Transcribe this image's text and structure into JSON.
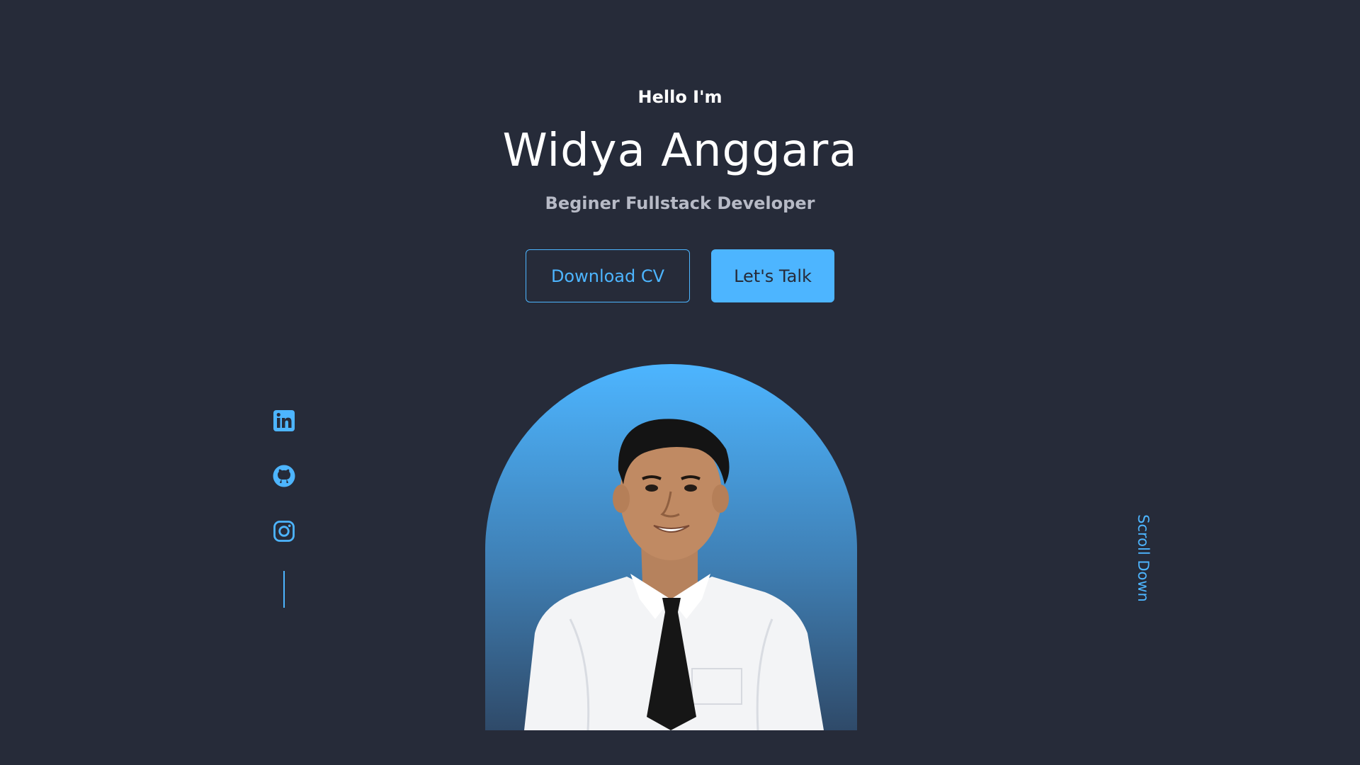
{
  "hero": {
    "greeting": "Hello I'm",
    "name": "Widya Anggara",
    "role": "Beginer Fullstack Developer",
    "buttons": {
      "download_cv": "Download CV",
      "lets_talk": "Let's Talk"
    }
  },
  "socials": [
    {
      "icon": "linkedin-icon"
    },
    {
      "icon": "github-icon"
    },
    {
      "icon": "instagram-icon"
    }
  ],
  "scroll_down": "Scroll Down",
  "colors": {
    "background": "#262b39",
    "accent": "#4db5ff",
    "text": "#ffffff",
    "muted_text": "#b7bac6"
  }
}
